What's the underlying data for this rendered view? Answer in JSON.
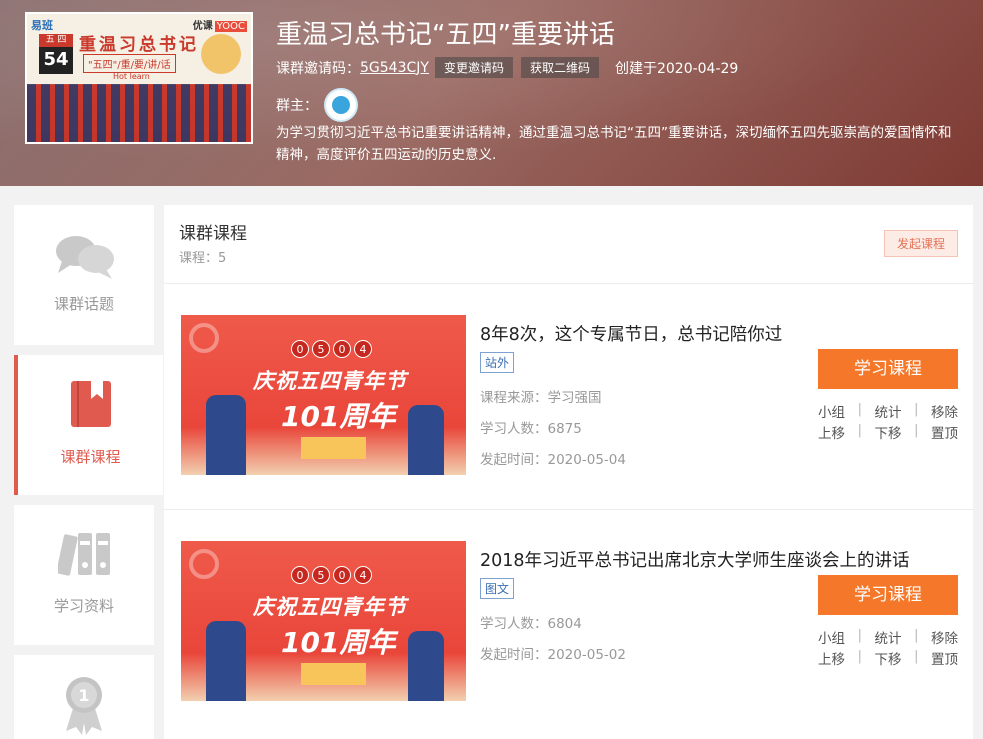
{
  "header": {
    "cover": {
      "logo_left": "易班",
      "logo_right_prefix": "优课",
      "logo_right_badge": "YOOC",
      "calendar_top": "五 四",
      "calendar_num": "54",
      "title": "重温习总书记",
      "subtitle": "\"五四\"/重/要/讲/话",
      "english": "Hot learn"
    },
    "title": "重温习总书记“五四”重要讲话",
    "invite_label": "课群邀请码：",
    "invite_code": "5G543CJY",
    "change_code_label": "变更邀请码",
    "qr_label": "获取二维码",
    "created_label": "创建于2020-04-29",
    "owner_label": "群主：",
    "description": "为学习贯彻习近平总书记重要讲话精神，通过重温习总书记“五四”重要讲话，深切缅怀五四先驱崇高的爱国情怀和",
    "description_line2": "精神，高度评价五四运动的历史意义."
  },
  "sidebar": {
    "items": [
      {
        "label": "课群话题",
        "icon": "chat-bubbles-icon"
      },
      {
        "label": "课群课程",
        "icon": "book-icon"
      },
      {
        "label": "学习资料",
        "icon": "binders-icon"
      },
      {
        "label": "",
        "icon": "medal-icon"
      }
    ]
  },
  "main": {
    "title": "课群课程",
    "count_label": "课程：5",
    "publish_label": "发起课程",
    "courses": [
      {
        "thumb_badge": [
          "0",
          "5",
          "0",
          "4"
        ],
        "thumb_title": "庆祝五四青年节",
        "thumb_subtitle": "101周年",
        "name": "8年8次，这个专属节日，总书记陪你过",
        "tag": "站外",
        "source": "课程来源：学习强国",
        "learners": "学习人数：6875",
        "date": "发起时间：2020-05-04",
        "study_label": "学习课程",
        "ops_row1": [
          "小组",
          "统计",
          "移除"
        ],
        "ops_row2": [
          "上移",
          "下移",
          "置顶"
        ]
      },
      {
        "thumb_badge": [
          "0",
          "5",
          "0",
          "4"
        ],
        "thumb_title": "庆祝五四青年节",
        "thumb_subtitle": "101周年",
        "name": "2018年习近平总书记出席北京大学师生座谈会上的讲话",
        "tag": "图文",
        "learners": "学习人数：6804",
        "date": "发起时间：2020-05-02",
        "study_label": "学习课程",
        "ops_row1": [
          "小组",
          "统计",
          "移除"
        ],
        "ops_row2": [
          "上移",
          "下移",
          "置顶"
        ]
      }
    ]
  },
  "colors": {
    "accent_orange": "#f5782a",
    "active_red": "#e05a4f",
    "tag_blue": "#3a6fb5"
  }
}
